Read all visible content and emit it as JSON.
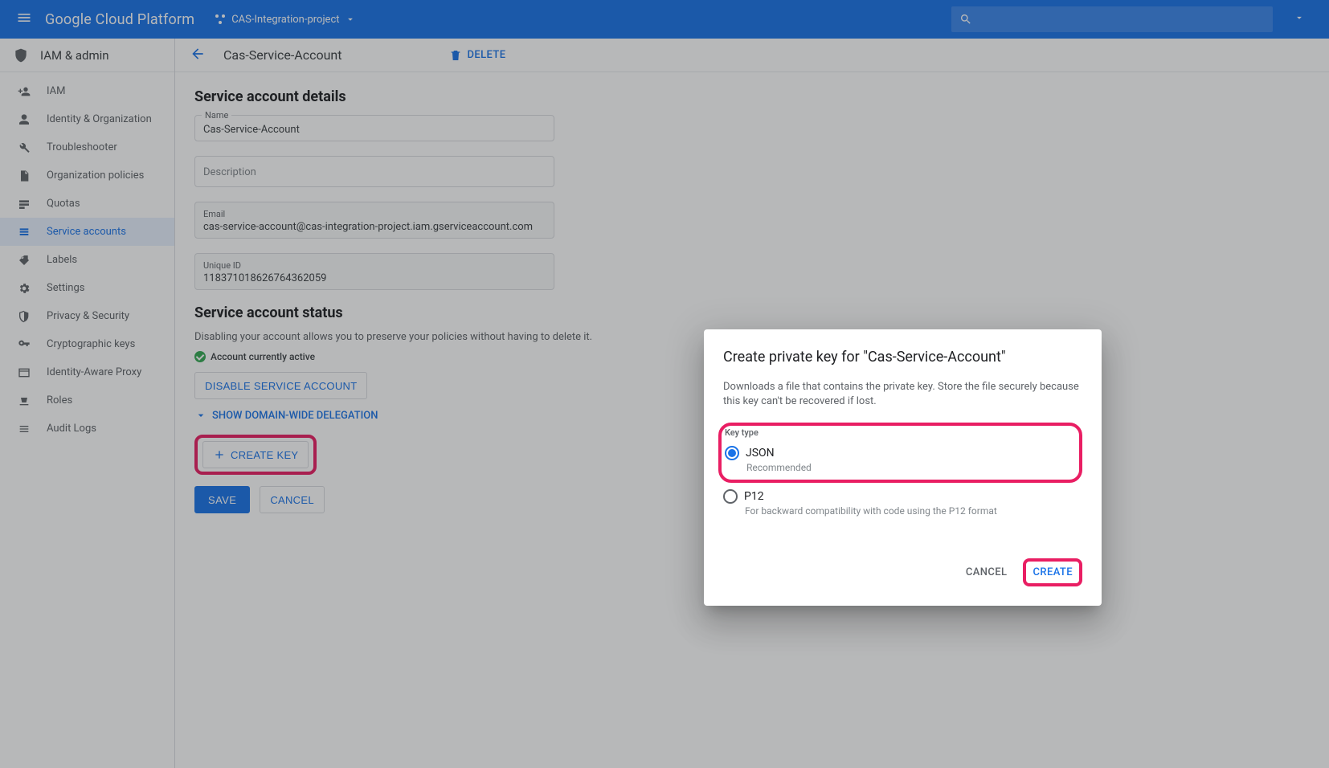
{
  "top": {
    "platform": "Google Cloud Platform",
    "project": "CAS-Integration-project"
  },
  "leftNav": {
    "header": "IAM & admin",
    "items": [
      {
        "icon": "person-add",
        "label": "IAM"
      },
      {
        "icon": "account",
        "label": "Identity & Organization"
      },
      {
        "icon": "wrench",
        "label": "Troubleshooter"
      },
      {
        "icon": "doc",
        "label": "Organization policies"
      },
      {
        "icon": "quota",
        "label": "Quotas"
      },
      {
        "icon": "service",
        "label": "Service accounts",
        "active": true
      },
      {
        "icon": "tag",
        "label": "Labels"
      },
      {
        "icon": "gear",
        "label": "Settings"
      },
      {
        "icon": "shield-half",
        "label": "Privacy & Security"
      },
      {
        "icon": "key",
        "label": "Cryptographic keys"
      },
      {
        "icon": "iap",
        "label": "Identity-Aware Proxy"
      },
      {
        "icon": "roles",
        "label": "Roles"
      },
      {
        "icon": "list",
        "label": "Audit Logs"
      }
    ]
  },
  "page": {
    "title": "Cas-Service-Account",
    "delete": "DELETE",
    "details": {
      "heading": "Service account details",
      "nameLabel": "Name",
      "nameVal": "Cas-Service-Account",
      "descPlaceholder": "Description",
      "emailLabel": "Email",
      "emailVal": "cas-service-account@cas-integration-project.iam.gserviceaccount.com",
      "uidLabel": "Unique ID",
      "uidVal": "118371018626764362059"
    },
    "status": {
      "heading": "Service account status",
      "desc": "Disabling your account allows you to preserve your policies without having to delete it.",
      "activeText": "Account currently active",
      "disableBtn": "DISABLE SERVICE ACCOUNT",
      "showDelegation": "SHOW DOMAIN-WIDE DELEGATION",
      "createKey": "CREATE KEY",
      "save": "SAVE",
      "cancel": "CANCEL"
    }
  },
  "dialog": {
    "title": "Create private key for \"Cas-Service-Account\"",
    "desc": "Downloads a file that contains the private key. Store the file securely because this key can't be recovered if lost.",
    "keyTypeLabel": "Key type",
    "json": {
      "label": "JSON",
      "sub": "Recommended"
    },
    "p12": {
      "label": "P12",
      "sub": "For backward compatibility with code using the P12 format"
    },
    "cancel": "CANCEL",
    "create": "CREATE"
  }
}
